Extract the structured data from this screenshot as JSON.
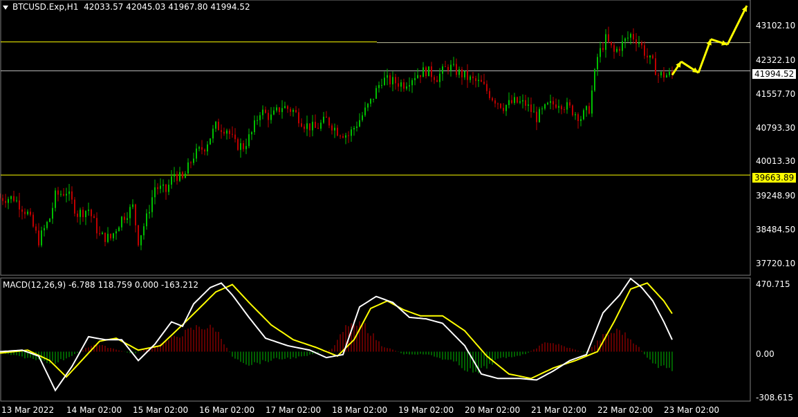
{
  "header": {
    "symbol": "BTCUSD.Exp,H1",
    "ohlc": "42033.57 42045.03 41967.80 41994.52"
  },
  "macd_header": {
    "text": "MACD(12,26,9) -6.788 118.759 0.000 -163.212"
  },
  "price_axis": {
    "labels": [
      "43102.10",
      "42322.10",
      "41557.70",
      "40793.30",
      "40013.30",
      "39248.90",
      "38484.50",
      "37720.10"
    ],
    "current_price": "41994.52",
    "level_price": "39663.89"
  },
  "macd_axis": {
    "labels": [
      "470.715",
      "0.00",
      "-308.615"
    ]
  },
  "time_axis": {
    "labels": [
      "13 Mar 2022",
      "14 Mar 02:00",
      "15 Mar 02:00",
      "16 Mar 02:00",
      "17 Mar 02:00",
      "18 Mar 02:00",
      "19 Mar 02:00",
      "20 Mar 02:00",
      "21 Mar 02:00",
      "22 Mar 02:00",
      "23 Mar 02:00"
    ]
  },
  "colors": {
    "background": "#000000",
    "bull": "#00c000",
    "bear": "#c00000",
    "level_line": "#ffff00",
    "price_line": "#c0c0c0",
    "macd_main": "#ffffff",
    "macd_signal": "#ffff00",
    "arrows": "#ffff00"
  },
  "chart_data": {
    "type": "candlestick",
    "price_range": [
      37500,
      43500
    ],
    "levels": [
      42640,
      39663.89
    ],
    "current_price": 41994.52,
    "candles_path": [
      [
        0,
        39150
      ],
      [
        5,
        39150
      ],
      [
        10,
        38800
      ],
      [
        14,
        38200
      ],
      [
        18,
        38700
      ],
      [
        20,
        39200
      ],
      [
        24,
        39300
      ],
      [
        28,
        38800
      ],
      [
        32,
        38900
      ],
      [
        36,
        38300
      ],
      [
        40,
        38250
      ],
      [
        44,
        38700
      ],
      [
        48,
        38950
      ],
      [
        50,
        38200
      ],
      [
        53,
        38700
      ],
      [
        56,
        39400
      ],
      [
        60,
        39300
      ],
      [
        63,
        39700
      ],
      [
        66,
        39550
      ],
      [
        70,
        40100
      ],
      [
        74,
        40300
      ],
      [
        78,
        40750
      ],
      [
        82,
        40700
      ],
      [
        85,
        40350
      ],
      [
        88,
        40300
      ],
      [
        91,
        40600
      ],
      [
        94,
        41100
      ],
      [
        98,
        40950
      ],
      [
        102,
        41200
      ],
      [
        106,
        41100
      ],
      [
        110,
        40800
      ],
      [
        114,
        40700
      ],
      [
        118,
        40900
      ],
      [
        122,
        40650
      ],
      [
        126,
        40550
      ],
      [
        130,
        40900
      ],
      [
        134,
        41300
      ],
      [
        138,
        41800
      ],
      [
        142,
        41750
      ],
      [
        146,
        41700
      ],
      [
        150,
        41900
      ],
      [
        154,
        42000
      ],
      [
        158,
        41850
      ],
      [
        162,
        42100
      ],
      [
        166,
        41950
      ],
      [
        170,
        41800
      ],
      [
        174,
        41700
      ],
      [
        178,
        41400
      ],
      [
        182,
        41200
      ],
      [
        186,
        41300
      ],
      [
        190,
        41250
      ],
      [
        194,
        40950
      ],
      [
        198,
        41200
      ],
      [
        202,
        41300
      ],
      [
        206,
        41150
      ],
      [
        210,
        40950
      ],
      [
        213,
        41150
      ],
      [
        216,
        42300
      ],
      [
        219,
        42700
      ],
      [
        222,
        42400
      ],
      [
        225,
        42600
      ],
      [
        228,
        42800
      ],
      [
        231,
        42650
      ],
      [
        234,
        42300
      ],
      [
        236,
        42150
      ],
      [
        238,
        41900
      ]
    ],
    "forecast_arrows": [
      [
        41900,
        42200
      ],
      [
        42200,
        41950
      ],
      [
        41950,
        42700
      ],
      [
        42700,
        42580
      ],
      [
        42580,
        43450
      ]
    ],
    "macd": {
      "range": [
        -308.615,
        470.715
      ],
      "main_path": [
        [
          0,
          0
        ],
        [
          8,
          10
        ],
        [
          14,
          -30
        ],
        [
          20,
          -260
        ],
        [
          26,
          -100
        ],
        [
          32,
          100
        ],
        [
          38,
          80
        ],
        [
          44,
          80
        ],
        [
          50,
          -60
        ],
        [
          56,
          50
        ],
        [
          62,
          200
        ],
        [
          66,
          170
        ],
        [
          70,
          320
        ],
        [
          76,
          430
        ],
        [
          80,
          460
        ],
        [
          84,
          380
        ],
        [
          90,
          230
        ],
        [
          96,
          90
        ],
        [
          104,
          40
        ],
        [
          112,
          10
        ],
        [
          118,
          -40
        ],
        [
          124,
          -20
        ],
        [
          130,
          300
        ],
        [
          136,
          370
        ],
        [
          142,
          330
        ],
        [
          148,
          230
        ],
        [
          154,
          220
        ],
        [
          160,
          190
        ],
        [
          168,
          40
        ],
        [
          174,
          -150
        ],
        [
          180,
          -180
        ],
        [
          188,
          -180
        ],
        [
          194,
          -190
        ],
        [
          200,
          -130
        ],
        [
          206,
          -60
        ],
        [
          212,
          -20
        ],
        [
          218,
          260
        ],
        [
          224,
          380
        ],
        [
          228,
          490
        ],
        [
          232,
          430
        ],
        [
          236,
          340
        ],
        [
          240,
          200
        ],
        [
          244,
          40
        ]
      ],
      "signal_path": [
        [
          0,
          -10
        ],
        [
          10,
          10
        ],
        [
          18,
          -60
        ],
        [
          24,
          -170
        ],
        [
          30,
          -50
        ],
        [
          36,
          70
        ],
        [
          42,
          90
        ],
        [
          50,
          10
        ],
        [
          58,
          40
        ],
        [
          66,
          180
        ],
        [
          72,
          290
        ],
        [
          78,
          400
        ],
        [
          84,
          450
        ],
        [
          90,
          330
        ],
        [
          98,
          180
        ],
        [
          106,
          80
        ],
        [
          114,
          30
        ],
        [
          122,
          -30
        ],
        [
          128,
          80
        ],
        [
          134,
          290
        ],
        [
          140,
          340
        ],
        [
          146,
          280
        ],
        [
          152,
          240
        ],
        [
          160,
          240
        ],
        [
          168,
          140
        ],
        [
          176,
          -30
        ],
        [
          184,
          -150
        ],
        [
          192,
          -180
        ],
        [
          200,
          -110
        ],
        [
          208,
          -60
        ],
        [
          216,
          0
        ],
        [
          222,
          200
        ],
        [
          228,
          420
        ],
        [
          234,
          460
        ],
        [
          240,
          340
        ],
        [
          246,
          170
        ]
      ],
      "histogram_profile": [
        [
          0,
          -10
        ],
        [
          20,
          -90
        ],
        [
          28,
          -10
        ],
        [
          34,
          60
        ],
        [
          40,
          30
        ],
        [
          48,
          -20
        ],
        [
          58,
          60
        ],
        [
          66,
          140
        ],
        [
          72,
          200
        ],
        [
          78,
          180
        ],
        [
          84,
          -40
        ],
        [
          90,
          -100
        ],
        [
          100,
          -60
        ],
        [
          110,
          -40
        ],
        [
          120,
          20
        ],
        [
          126,
          220
        ],
        [
          132,
          200
        ],
        [
          138,
          50
        ],
        [
          146,
          -20
        ],
        [
          154,
          -20
        ],
        [
          164,
          -80
        ],
        [
          172,
          -180
        ],
        [
          180,
          -60
        ],
        [
          190,
          -20
        ],
        [
          198,
          80
        ],
        [
          204,
          40
        ],
        [
          212,
          -10
        ],
        [
          218,
          120
        ],
        [
          224,
          170
        ],
        [
          230,
          60
        ],
        [
          236,
          -100
        ],
        [
          244,
          -160
        ]
      ]
    }
  }
}
